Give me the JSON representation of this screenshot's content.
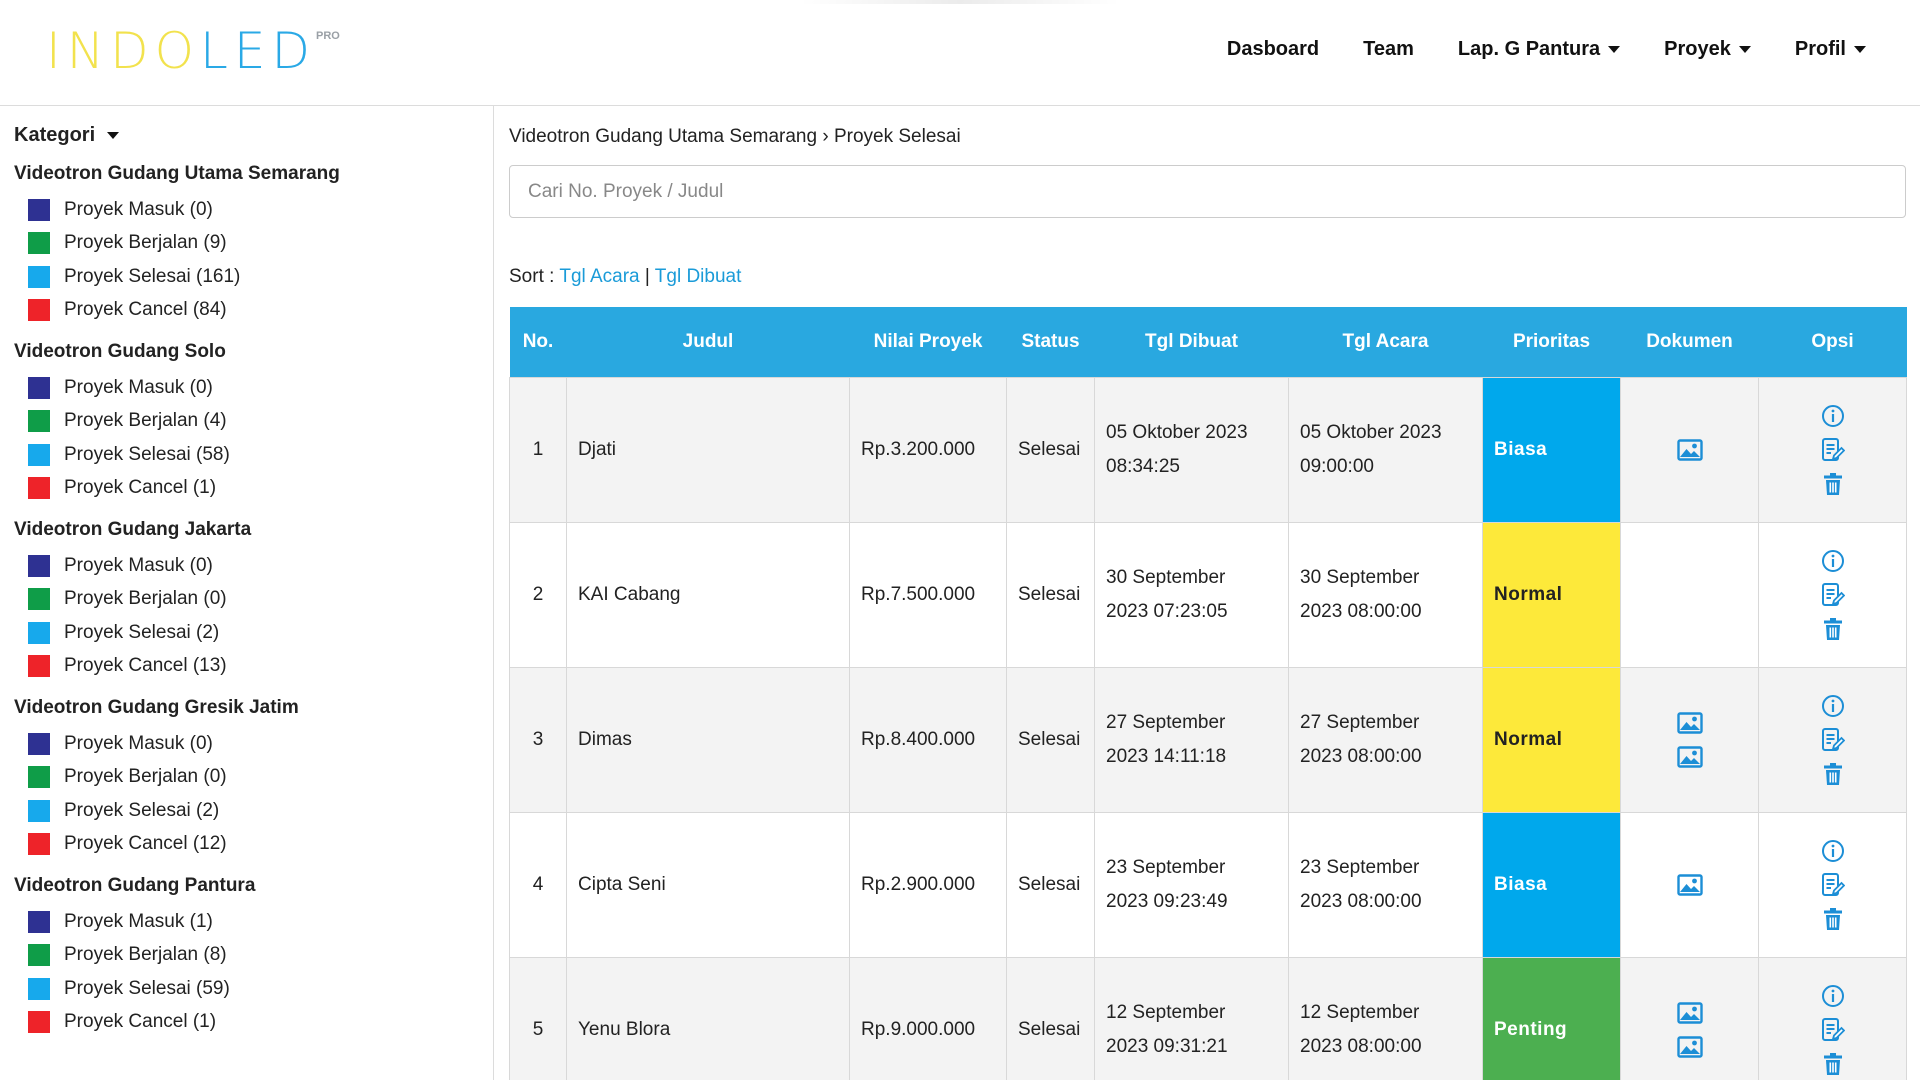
{
  "header": {
    "logo_text": "INDOLED",
    "logo_badge": "PRO",
    "nav": [
      {
        "label": "Dasboard",
        "dropdown": false
      },
      {
        "label": "Team",
        "dropdown": false
      },
      {
        "label": "Lap. G Pantura",
        "dropdown": true
      },
      {
        "label": "Proyek",
        "dropdown": true
      },
      {
        "label": "Profil",
        "dropdown": true
      }
    ]
  },
  "sidebar": {
    "title": "Kategori",
    "groups": [
      {
        "title": "Videotron Gudang Utama Semarang",
        "items": [
          {
            "label": "Proyek Masuk (0)",
            "color": "#2e3192"
          },
          {
            "label": "Proyek Berjalan (9)",
            "color": "#0f9d48"
          },
          {
            "label": "Proyek Selesai (161)",
            "color": "#17a9ec"
          },
          {
            "label": "Proyek Cancel (84)",
            "color": "#ee2329"
          }
        ]
      },
      {
        "title": "Videotron Gudang Solo",
        "items": [
          {
            "label": "Proyek Masuk (0)",
            "color": "#2e3192"
          },
          {
            "label": "Proyek Berjalan (4)",
            "color": "#0f9d48"
          },
          {
            "label": "Proyek Selesai (58)",
            "color": "#17a9ec"
          },
          {
            "label": "Proyek Cancel (1)",
            "color": "#ee2329"
          }
        ]
      },
      {
        "title": "Videotron Gudang Jakarta",
        "items": [
          {
            "label": "Proyek Masuk (0)",
            "color": "#2e3192"
          },
          {
            "label": "Proyek Berjalan (0)",
            "color": "#0f9d48"
          },
          {
            "label": "Proyek Selesai (2)",
            "color": "#17a9ec"
          },
          {
            "label": "Proyek Cancel (13)",
            "color": "#ee2329"
          }
        ]
      },
      {
        "title": "Videotron Gudang Gresik Jatim",
        "items": [
          {
            "label": "Proyek Masuk (0)",
            "color": "#2e3192"
          },
          {
            "label": "Proyek Berjalan (0)",
            "color": "#0f9d48"
          },
          {
            "label": "Proyek Selesai (2)",
            "color": "#17a9ec"
          },
          {
            "label": "Proyek Cancel (12)",
            "color": "#ee2329"
          }
        ]
      },
      {
        "title": "Videotron Gudang Pantura",
        "items": [
          {
            "label": "Proyek Masuk (1)",
            "color": "#2e3192"
          },
          {
            "label": "Proyek Berjalan (8)",
            "color": "#0f9d48"
          },
          {
            "label": "Proyek Selesai (59)",
            "color": "#17a9ec"
          },
          {
            "label": "Proyek Cancel (1)",
            "color": "#ee2329"
          }
        ]
      }
    ]
  },
  "main": {
    "breadcrumb": "Videotron Gudang Utama Semarang › Proyek Selesai",
    "search_placeholder": "Cari No. Proyek / Judul",
    "sort_label": "Sort :",
    "sort_links": [
      "Tgl Acara",
      "Tgl Dibuat"
    ],
    "sort_sep": "|",
    "columns": [
      "No.",
      "Judul",
      "Nilai Proyek",
      "Status",
      "Tgl Dibuat",
      "Tgl Acara",
      "Prioritas",
      "Dokumen",
      "Opsi"
    ],
    "rows": [
      {
        "no": "1",
        "judul": "Djati",
        "nilai": "Rp.3.200.000",
        "status": "Selesai",
        "dibuat": [
          "05 Oktober 2023",
          "08:34:25"
        ],
        "acara": [
          "05 Oktober 2023",
          "09:00:00"
        ],
        "prioritas": "Biasa",
        "dokumen": 1
      },
      {
        "no": "2",
        "judul": "KAI Cabang",
        "nilai": "Rp.7.500.000",
        "status": "Selesai",
        "dibuat": [
          "30 September",
          "2023 07:23:05"
        ],
        "acara": [
          "30 September",
          "2023 08:00:00"
        ],
        "prioritas": "Normal",
        "dokumen": 0
      },
      {
        "no": "3",
        "judul": "Dimas",
        "nilai": "Rp.8.400.000",
        "status": "Selesai",
        "dibuat": [
          "27 September",
          "2023 14:11:18"
        ],
        "acara": [
          "27 September",
          "2023 08:00:00"
        ],
        "prioritas": "Normal",
        "dokumen": 2
      },
      {
        "no": "4",
        "judul": "Cipta Seni",
        "nilai": "Rp.2.900.000",
        "status": "Selesai",
        "dibuat": [
          "23 September",
          "2023 09:23:49"
        ],
        "acara": [
          "23 September",
          "2023 08:00:00"
        ],
        "prioritas": "Biasa",
        "dokumen": 1
      },
      {
        "no": "5",
        "judul": "Yenu Blora",
        "nilai": "Rp.9.000.000",
        "status": "Selesai",
        "dibuat": [
          "12 September",
          "2023 09:31:21"
        ],
        "acara": [
          "12 September",
          "2023 08:00:00"
        ],
        "prioritas": "Penting",
        "dokumen": 2
      }
    ],
    "priority_colors": {
      "Biasa": "#00a8ec",
      "Normal": "#fde93a",
      "Penting": "#4caf50"
    }
  },
  "colors": {
    "accent": "#29a8e0",
    "link": "#1a9bd8",
    "icon": "#1c8ed6",
    "logo_yellow": "#f2e24d",
    "logo_blue": "#2aa9e6"
  },
  "icons": {
    "nav_dropdown": "caret-down-icon",
    "dokumen": "image-icon",
    "opsi": [
      "info-icon",
      "edit-icon",
      "trash-icon"
    ]
  }
}
